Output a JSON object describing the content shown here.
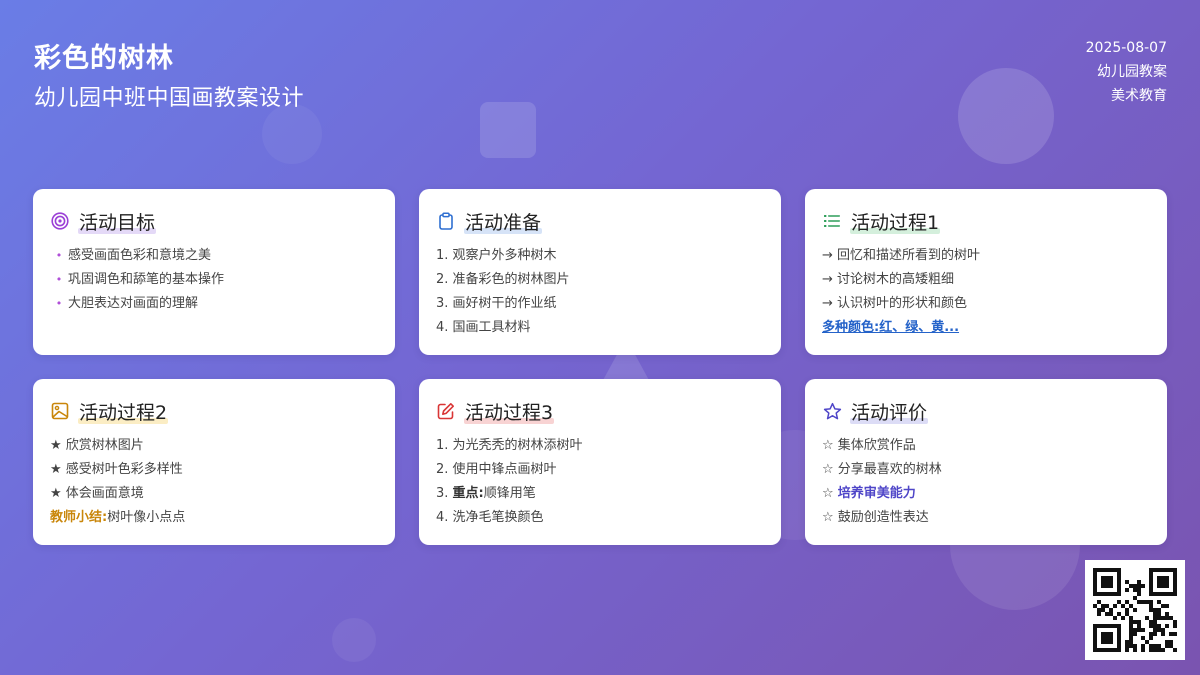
{
  "header": {
    "title": "彩色的树林",
    "subtitle": "幼儿园中班中国画教案设计",
    "date": "2025-08-07",
    "category": "幼儿园教案",
    "subject": "美术教育"
  },
  "colors": {
    "purple": "#9b3fd6",
    "blue": "#2f6fd1",
    "green": "#2e9e5a",
    "amber": "#c9860a",
    "red": "#d93636",
    "indigo": "#4f46c8"
  },
  "cards": [
    {
      "icon": "target-icon",
      "title": "活动目标",
      "items": [
        "感受画面色彩和意境之美",
        "巩固调色和舔笔的基本操作",
        "大胆表达对画面的理解"
      ]
    },
    {
      "icon": "clipboard-icon",
      "title": "活动准备",
      "items": [
        "1. 观察户外多种树木",
        "2. 准备彩色的树林图片",
        "3. 画好树干的作业纸",
        "4. 国画工具材料"
      ]
    },
    {
      "icon": "list-icon",
      "title": "活动过程1",
      "items": [
        "→ 回忆和描述所看到的树叶",
        "→ 讨论树木的高矮粗细",
        "→ 认识树叶的形状和颜色"
      ],
      "highlight": "多种颜色:红、绿、黄..."
    },
    {
      "icon": "image-icon",
      "title": "活动过程2",
      "items": [
        "★ 欣赏树林图片",
        "★ 感受树叶色彩多样性",
        "★ 体会画面意境"
      ],
      "note_label": "教师小结:",
      "note_text": "树叶像小点点"
    },
    {
      "icon": "edit-icon",
      "title": "活动过程3",
      "items": [
        "1. 为光秃秃的树林添树叶",
        "2. 使用中锋点画树叶"
      ],
      "item3_prefix": "3. ",
      "item3_bold": "重点:",
      "item3_text": "顺锋用笔",
      "item4": "4. 洗净毛笔换颜色"
    },
    {
      "icon": "star-icon",
      "title": "活动评价",
      "items": [
        "☆ 集体欣赏作品",
        "☆ 分享最喜欢的树林"
      ],
      "item3_prefix": "☆ ",
      "item3_emph": "培养审美能力",
      "item4": "☆ 鼓励创造性表达"
    }
  ]
}
